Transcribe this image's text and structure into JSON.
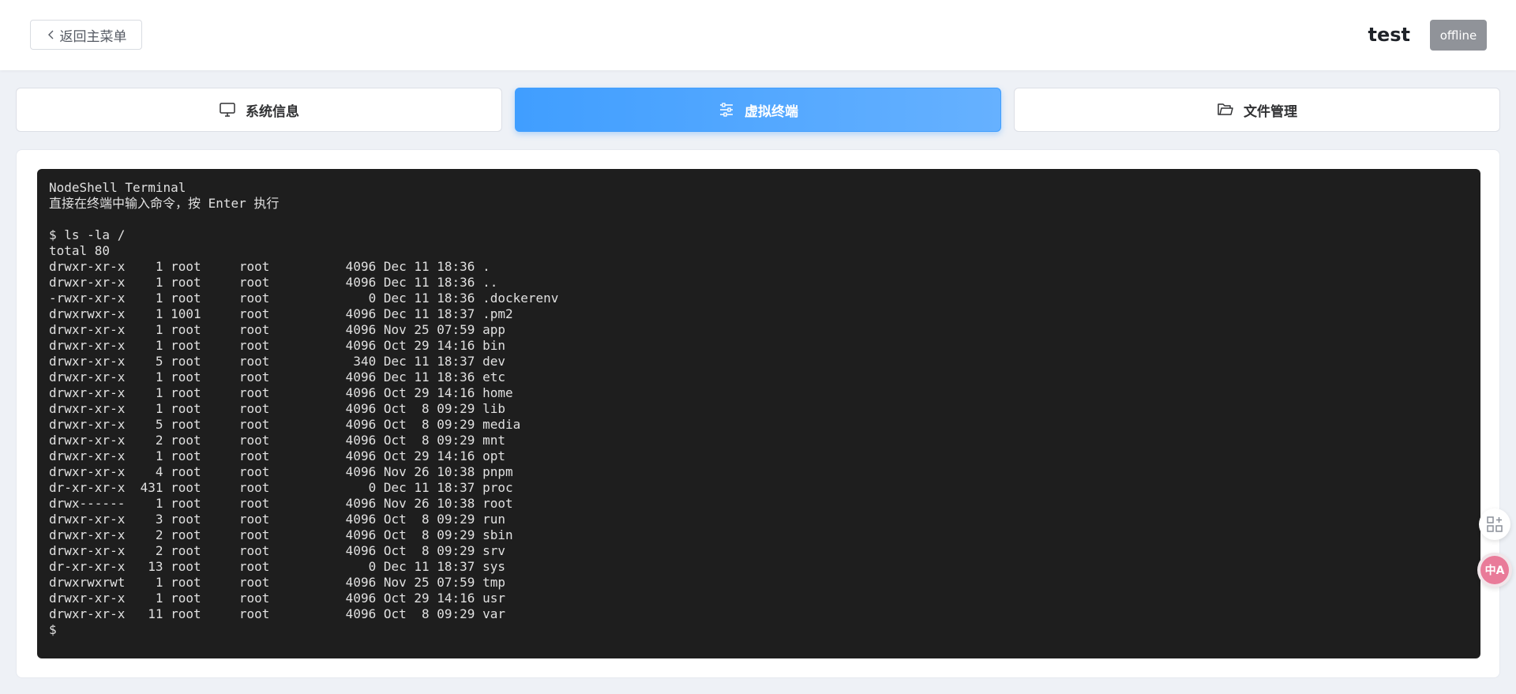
{
  "header": {
    "back_label": "返回主菜单",
    "server_name": "test",
    "status": "offline"
  },
  "tabs": [
    {
      "label": "系统信息",
      "icon": "monitor-icon",
      "active": false
    },
    {
      "label": "虚拟终端",
      "icon": "sliders-icon",
      "active": true
    },
    {
      "label": "文件管理",
      "icon": "folder-icon",
      "active": false
    }
  ],
  "terminal": {
    "lines": [
      "NodeShell Terminal",
      "直接在终端中输入命令，按 Enter 执行",
      "",
      "$ ls -la /",
      "total 80",
      "drwxr-xr-x    1 root     root          4096 Dec 11 18:36 .",
      "drwxr-xr-x    1 root     root          4096 Dec 11 18:36 ..",
      "-rwxr-xr-x    1 root     root             0 Dec 11 18:36 .dockerenv",
      "drwxrwxr-x    1 1001     root          4096 Dec 11 18:37 .pm2",
      "drwxr-xr-x    1 root     root          4096 Nov 25 07:59 app",
      "drwxr-xr-x    1 root     root          4096 Oct 29 14:16 bin",
      "drwxr-xr-x    5 root     root           340 Dec 11 18:37 dev",
      "drwxr-xr-x    1 root     root          4096 Dec 11 18:36 etc",
      "drwxr-xr-x    1 root     root          4096 Oct 29 14:16 home",
      "drwxr-xr-x    1 root     root          4096 Oct  8 09:29 lib",
      "drwxr-xr-x    5 root     root          4096 Oct  8 09:29 media",
      "drwxr-xr-x    2 root     root          4096 Oct  8 09:29 mnt",
      "drwxr-xr-x    1 root     root          4096 Oct 29 14:16 opt",
      "drwxr-xr-x    4 root     root          4096 Nov 26 10:38 pnpm",
      "dr-xr-xr-x  431 root     root             0 Dec 11 18:37 proc",
      "drwx------    1 root     root          4096 Nov 26 10:38 root",
      "drwxr-xr-x    3 root     root          4096 Oct  8 09:29 run",
      "drwxr-xr-x    2 root     root          4096 Oct  8 09:29 sbin",
      "drwxr-xr-x    2 root     root          4096 Oct  8 09:29 srv",
      "dr-xr-xr-x   13 root     root             0 Dec 11 18:37 sys",
      "drwxrwxrwt    1 root     root          4096 Nov 25 07:59 tmp",
      "drwxr-xr-x    1 root     root          4096 Oct 29 14:16 usr",
      "drwxr-xr-x   11 root     root          4096 Oct  8 09:29 var",
      "$ "
    ]
  },
  "floating": {
    "apps_icon": "add-apps-icon",
    "translate_label": "中A"
  },
  "colors": {
    "accent": "#409eff",
    "terminal_bg": "#1e1e1e",
    "status_offline": "#909399"
  }
}
